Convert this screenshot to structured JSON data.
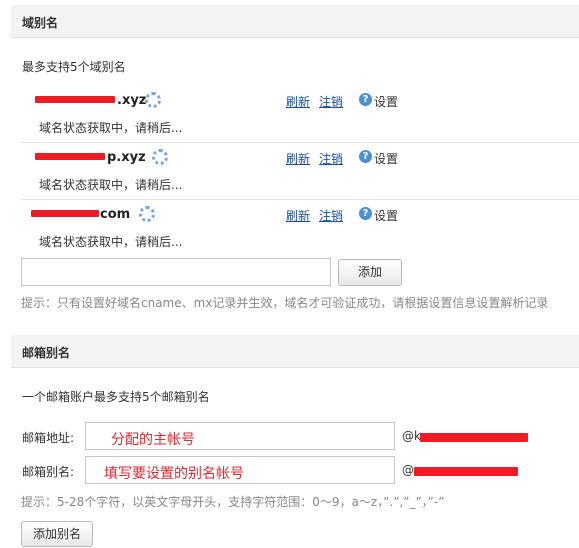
{
  "alias_section": {
    "title": "域别名",
    "limit_text": "最多支持5个域别名",
    "domains": [
      {
        "name": ".xyz",
        "status": "域名状态获取中，请稍后...",
        "refresh": "刷新",
        "cancel": "注销",
        "settings": "设置"
      },
      {
        "name": "p.xyz",
        "status": "域名状态获取中，请稍后...",
        "refresh": "刷新",
        "cancel": "注销",
        "settings": "设置"
      },
      {
        "name": "com",
        "status": "域名状态获取中，请稍后...",
        "refresh": "刷新",
        "cancel": "注销",
        "settings": "设置"
      }
    ],
    "add_input_value": "",
    "add_button": "添加",
    "hint": "提示：只有设置好域名cname、mx记录并生效，域名才可验证成功，请根据设置信息设置解析记录"
  },
  "mailbox_section": {
    "title": "邮箱别名",
    "limit_text": "一个邮箱账户最多支持5个邮箱别名",
    "address_label": "邮箱地址:",
    "address_overlay": "分配的主帐号",
    "address_suffix": "@k",
    "alias_label": "邮箱别名:",
    "alias_overlay": "填写要设置的别名帐号",
    "alias_suffix": "@",
    "hint": "提示：5-28个字符，以英文字母开头，支持字符范围：0～9，a～z，”.”,”_”，”-”",
    "add_button": "添加别名"
  },
  "colors": {
    "link": "#1a4fa3",
    "redaction": "#ee1c24",
    "header_bg": "#f3f3f3"
  },
  "icons": [
    "loading-spinner-icon",
    "help-icon"
  ]
}
